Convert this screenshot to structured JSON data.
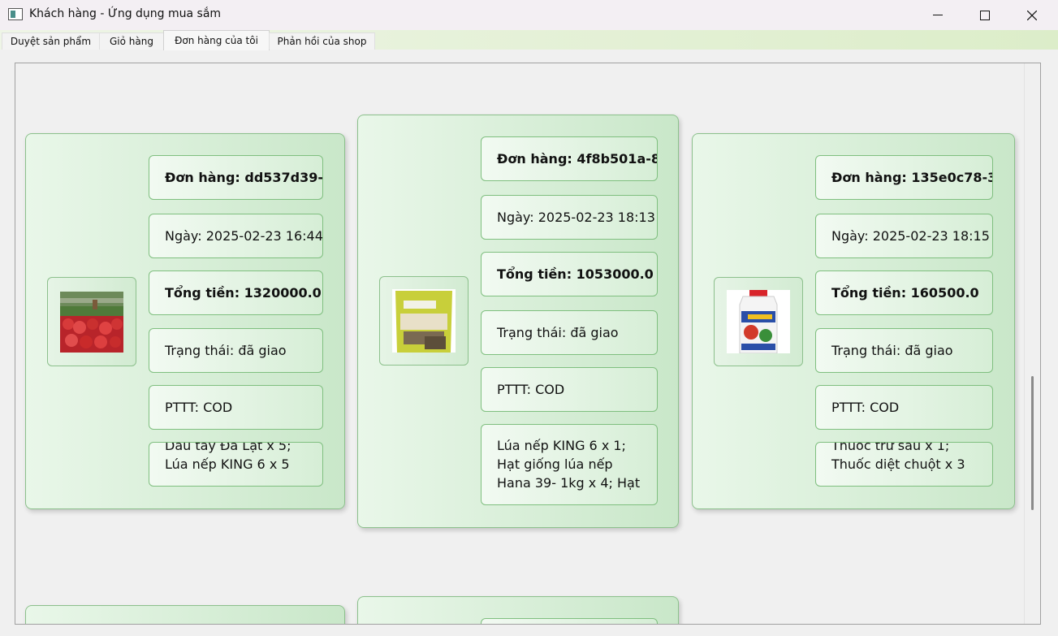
{
  "window": {
    "title": "Khách hàng - Ứng dụng mua sắm"
  },
  "tabs": [
    {
      "label": "Duyệt sản phẩm"
    },
    {
      "label": "Giỏ hàng"
    },
    {
      "label": "Đơn hàng của tôi",
      "active": true
    },
    {
      "label": "Phản hồi của shop"
    }
  ],
  "orders": [
    {
      "order_id": "Đơn hàng: dd537d39-",
      "date": "Ngày: 2025-02-23 16:44",
      "total": "Tổng tiền: 1320000.0",
      "status": "Trạng thái: đã giao",
      "payment": "PTTT: COD",
      "items": "Dâu tây Đà Lạt x 5; Lúa nếp KING 6 x 5",
      "image": "strawberry-photo"
    },
    {
      "order_id": "Đơn hàng: 4f8b501a-8",
      "date": "Ngày: 2025-02-23 18:13",
      "total": "Tổng tiền: 1053000.0",
      "status": "Trạng thái: đã giao",
      "payment": "PTTT: COD",
      "items": "Lúa nếp KING 6 x 1; Hạt giống lúa nếp Hana 39- 1kg x 4; Hạt",
      "image": "seed-bag-photo"
    },
    {
      "order_id": "Đơn hàng: 135e0c78-3",
      "date": "Ngày: 2025-02-23 18:15",
      "total": "Tổng tiền: 160500.0",
      "status": "Trạng thái: đã giao",
      "payment": "PTTT: COD",
      "items": "Thuốc trừ sâu x 1; Thuốc diệt chuột x 3",
      "image": "pesticide-bottle-photo"
    }
  ],
  "colors": {
    "card_border": "#8cc08c",
    "card_bg_start": "#e9f7e9",
    "card_bg_end": "#c9e7c9",
    "tabbar_bg": "#dcedc9"
  }
}
